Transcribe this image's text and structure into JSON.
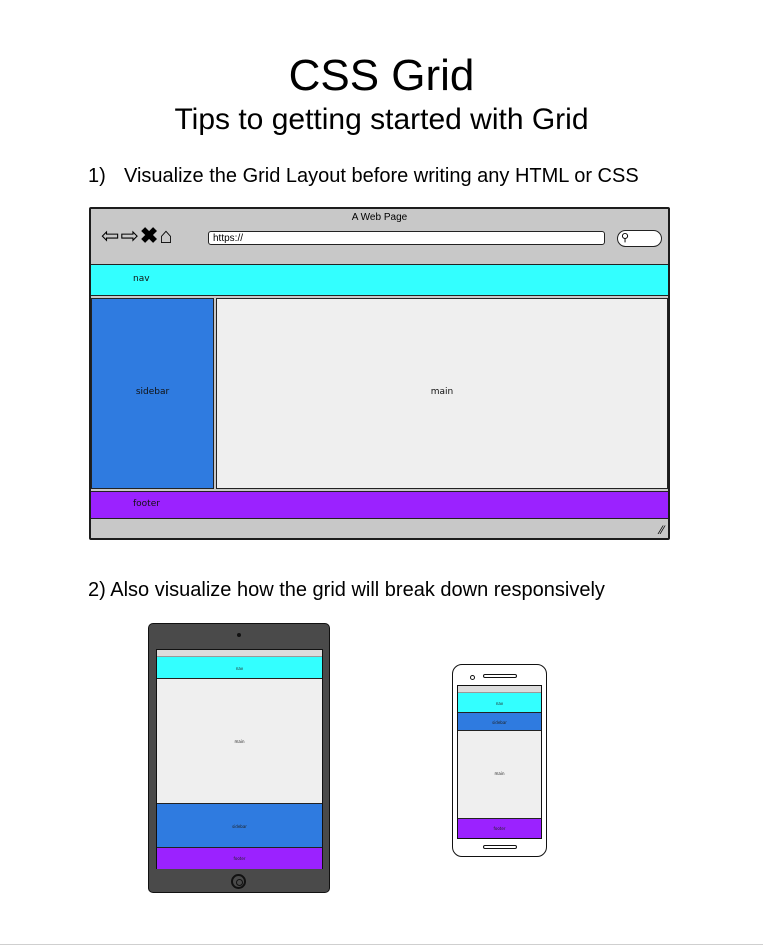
{
  "header": {
    "title": "CSS Grid",
    "subtitle": "Tips to getting started with Grid"
  },
  "steps": [
    {
      "number": "1)",
      "text": "Visualize the Grid Layout before writing any HTML or CSS"
    },
    {
      "text": "2) Also visualize how the grid will break down responsively"
    }
  ],
  "desktop_mockup": {
    "window_title": "A Web Page",
    "url": "https://",
    "toolbar_icons": [
      "back-arrow-icon",
      "forward-arrow-icon",
      "close-icon",
      "home-icon",
      "search-icon"
    ],
    "regions": {
      "nav": "nav",
      "sidebar": "sidebar",
      "main": "main",
      "footer": "footer"
    }
  },
  "tablet_mockup": {
    "regions": [
      "nav",
      "main",
      "sidebar",
      "footer"
    ]
  },
  "phone_mockup": {
    "regions": [
      "nav",
      "sidebar",
      "main",
      "footer"
    ]
  },
  "colors": {
    "nav": "#33ffff",
    "sidebar": "#2f7be0",
    "main": "#efefef",
    "footer": "#9b22ff",
    "chrome": "#c8c8c8",
    "device": "#4a4a4a"
  }
}
